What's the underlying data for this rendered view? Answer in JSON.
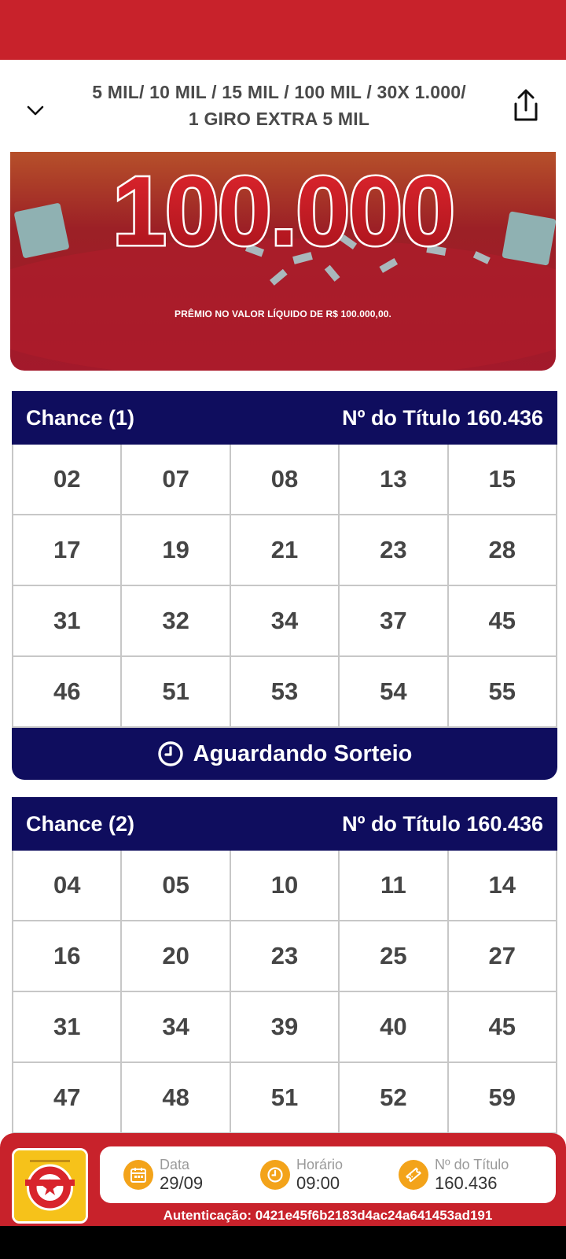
{
  "header": {
    "title_line1": "5 MIL/ 10 MIL / 15 MIL / 100 MIL / 30X 1.000/",
    "title_line2": "1 GIRO EXTRA 5 MIL"
  },
  "banner": {
    "headline": "100.000",
    "caption": "PRÊMIO NO VALOR LÍQUIDO DE R$ 100.000,00."
  },
  "chances": [
    {
      "label": "Chance (1)",
      "titulo": "Nº do Título 160.436",
      "numbers": [
        "02",
        "07",
        "08",
        "13",
        "15",
        "17",
        "19",
        "21",
        "23",
        "28",
        "31",
        "32",
        "34",
        "37",
        "45",
        "46",
        "51",
        "53",
        "54",
        "55"
      ],
      "status": "Aguardando Sorteio"
    },
    {
      "label": "Chance (2)",
      "titulo": "Nº do Título 160.436",
      "numbers": [
        "04",
        "05",
        "10",
        "11",
        "14",
        "16",
        "20",
        "23",
        "25",
        "27",
        "31",
        "34",
        "39",
        "40",
        "45",
        "47",
        "48",
        "51",
        "52",
        "59"
      ]
    }
  ],
  "footer": {
    "data_label": "Data",
    "data_value": "29/09",
    "horario_label": "Horário",
    "horario_value": "09:00",
    "titulo_label": "Nº do Título",
    "titulo_value": "160.436",
    "auth": "Autenticação: 0421e45f6b2183d4ac24a641453ad191"
  },
  "colors": {
    "brand_red": "#c8222b",
    "navy": "#0f0d5e",
    "orange": "#f3a31a"
  },
  "icons": [
    "chevron-down-icon",
    "share-icon",
    "clock-icon",
    "calendar-icon",
    "ticket-icon"
  ]
}
